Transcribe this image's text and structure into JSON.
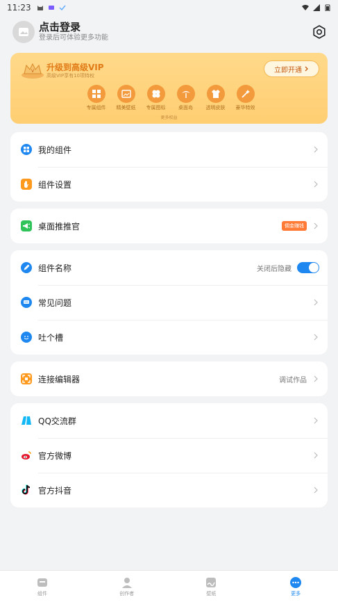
{
  "status_bar": {
    "time": "11:23"
  },
  "header": {
    "login_title": "点击登录",
    "login_subtitle": "登录后可体验更多功能"
  },
  "vip": {
    "title": "升级到高级VIP",
    "subtitle": "高级VIP享有10项特权",
    "button_label": "立即开通",
    "features": [
      {
        "label": "专属组件",
        "icon": "widget-icon"
      },
      {
        "label": "精美壁纸",
        "icon": "wallpaper-icon"
      },
      {
        "label": "专属图标",
        "icon": "clover-icon"
      },
      {
        "label": "桌面岛",
        "icon": "palm-icon"
      },
      {
        "label": "透明皮肤",
        "icon": "shirt-icon"
      },
      {
        "label": "豪华特效",
        "icon": "magic-icon"
      }
    ],
    "more_label": "更多权益"
  },
  "sections": {
    "widgets": [
      {
        "label": "我的组件",
        "icon": "grid-icon",
        "color": "#1e88f0"
      },
      {
        "label": "组件设置",
        "icon": "hand-icon",
        "color": "#ff9a1f"
      }
    ],
    "promoter": {
      "label": "桌面推推官",
      "badge": "佣金赚钱",
      "icon": "megaphone-icon",
      "color": "#2fc35a"
    },
    "misc": [
      {
        "label": "组件名称",
        "right_text": "关闭后隐藏",
        "toggle_on": true,
        "icon": "pen-icon",
        "color": "#1e88f0"
      },
      {
        "label": "常见问题",
        "icon": "chat-icon",
        "color": "#1e88f0"
      },
      {
        "label": "吐个槽",
        "icon": "smile-icon",
        "color": "#1e88f0"
      }
    ],
    "editor": {
      "label": "连接编辑器",
      "right_text": "调试作品",
      "icon": "scan-icon",
      "color": "#ff9a1f"
    },
    "social": [
      {
        "label": "QQ交流群",
        "icon": "qq-icon",
        "color": "#12b7f5"
      },
      {
        "label": "官方微博",
        "icon": "weibo-icon",
        "color": "#e6162d"
      },
      {
        "label": "官方抖音",
        "icon": "douyin-icon",
        "color": "#111111"
      }
    ]
  },
  "bottom_nav": [
    {
      "label": "组件",
      "icon": "widget-nav-icon",
      "active": false
    },
    {
      "label": "创作者",
      "icon": "creator-nav-icon",
      "active": false
    },
    {
      "label": "壁纸",
      "icon": "wallpaper-nav-icon",
      "active": false
    },
    {
      "label": "更多",
      "icon": "more-nav-icon",
      "active": true
    }
  ],
  "colors": {
    "accent": "#1e88f0",
    "vip_bg": "#ffd98a",
    "vip_text": "#e07b17"
  }
}
